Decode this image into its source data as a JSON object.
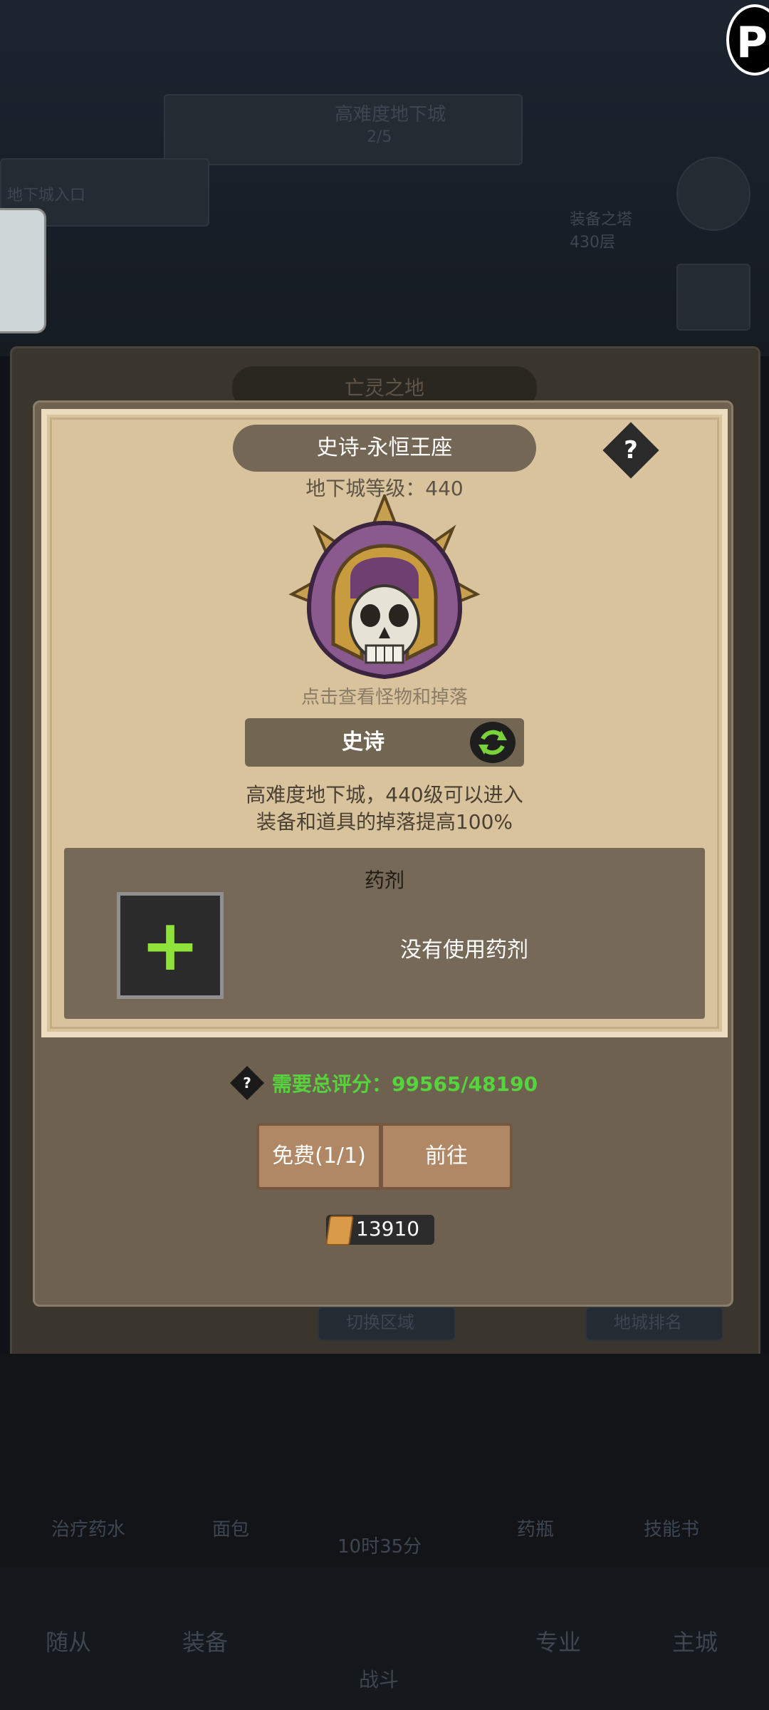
{
  "background": {
    "top_banner": "高难度地下城",
    "top_banner_sub": "2/5",
    "left_tag": "地下城入口",
    "right_label": "装备之塔",
    "right_label_sub": "430层",
    "back_title": "亡灵之地",
    "back_left_button": "切换区域",
    "back_right_button": "地城排名",
    "hud": [
      "治疗药水",
      "面包",
      "10时35分",
      "药瓶",
      "技能书"
    ],
    "nav": [
      "随从",
      "装备",
      "战斗",
      "专业",
      "主城"
    ]
  },
  "dungeon": {
    "title": "史诗-永恒王座",
    "help": "?",
    "level_text": "地下城等级：440",
    "tap_hint": "点击查看怪物和掉落",
    "difficulty": "史诗",
    "desc_line1": "高难度地下城，440级可以进入",
    "desc_line2": "装备和道具的掉落提高100%"
  },
  "potion": {
    "title": "药剂",
    "empty_text": "没有使用药剂",
    "add_symbol": "+"
  },
  "requirement": {
    "help": "?",
    "text": "需要总评分：99565/48190"
  },
  "actions": {
    "free_label": "免费(1/1)",
    "go_label": "前往"
  },
  "currency": {
    "value": "13910"
  },
  "colors": {
    "accent_green": "#56d43e",
    "plus_green": "#8ee23a",
    "card_bg": "#d8c39c",
    "panel_brown": "#6e6150",
    "button_brown": "#b08866"
  },
  "icons": {
    "boss": "helmet-skull-icon",
    "swap": "refresh-icon",
    "currency": "scroll-icon",
    "corner": "p-badge-icon"
  }
}
